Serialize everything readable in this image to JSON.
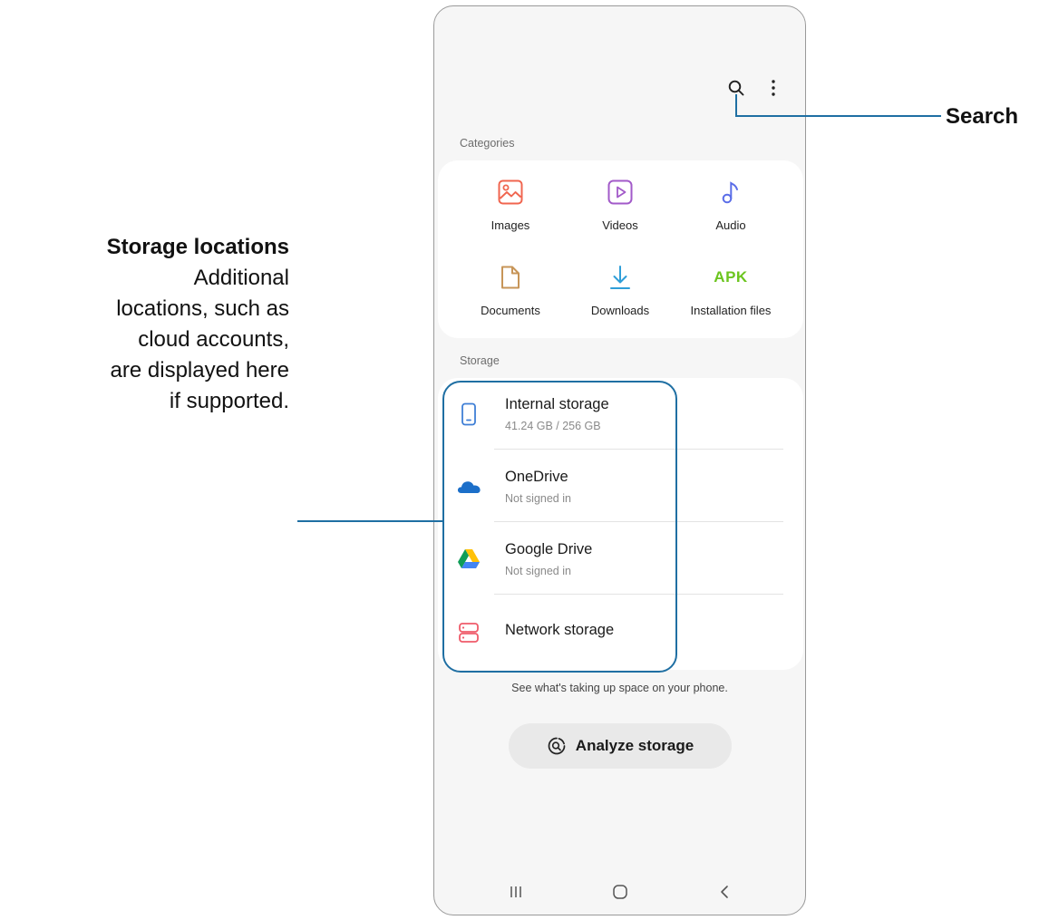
{
  "toolbar": {
    "search_icon": "search-icon",
    "more_icon": "more-options-icon"
  },
  "categories": {
    "label": "Categories",
    "items": [
      {
        "label": "Images",
        "icon": "image-icon",
        "color": "#f0654f"
      },
      {
        "label": "Videos",
        "icon": "video-icon",
        "color": "#a25ac9"
      },
      {
        "label": "Audio",
        "icon": "music-note-icon",
        "color": "#5b6ee8"
      },
      {
        "label": "Documents",
        "icon": "document-icon",
        "color": "#c79558"
      },
      {
        "label": "Downloads",
        "icon": "download-icon",
        "color": "#2f9ed8"
      },
      {
        "label": "Installation files",
        "icon_text": "APK",
        "color": "#6cc51f"
      }
    ]
  },
  "storage": {
    "label": "Storage",
    "items": [
      {
        "title": "Internal storage",
        "subtitle": "41.24 GB / 256 GB",
        "icon": "phone-icon",
        "color": "#3f7fd6"
      },
      {
        "title": "OneDrive",
        "subtitle": "Not signed in",
        "icon": "onedrive-icon",
        "color": "#1c6fc9"
      },
      {
        "title": "Google Drive",
        "subtitle": "Not signed in",
        "icon": "google-drive-icon"
      },
      {
        "title": "Network storage",
        "icon": "network-storage-icon",
        "color": "#ef5b6a"
      }
    ]
  },
  "analyze": {
    "hint": "See what's taking up space on your phone.",
    "button_label": "Analyze storage"
  },
  "nav": {
    "recents": "recents-icon",
    "home": "home-icon",
    "back": "back-icon"
  },
  "callouts": {
    "search": "Search",
    "storage_title": "Storage locations",
    "storage_body_lines": [
      "Additional",
      "locations, such as",
      "cloud accounts,",
      "are displayed here",
      "if supported."
    ]
  }
}
